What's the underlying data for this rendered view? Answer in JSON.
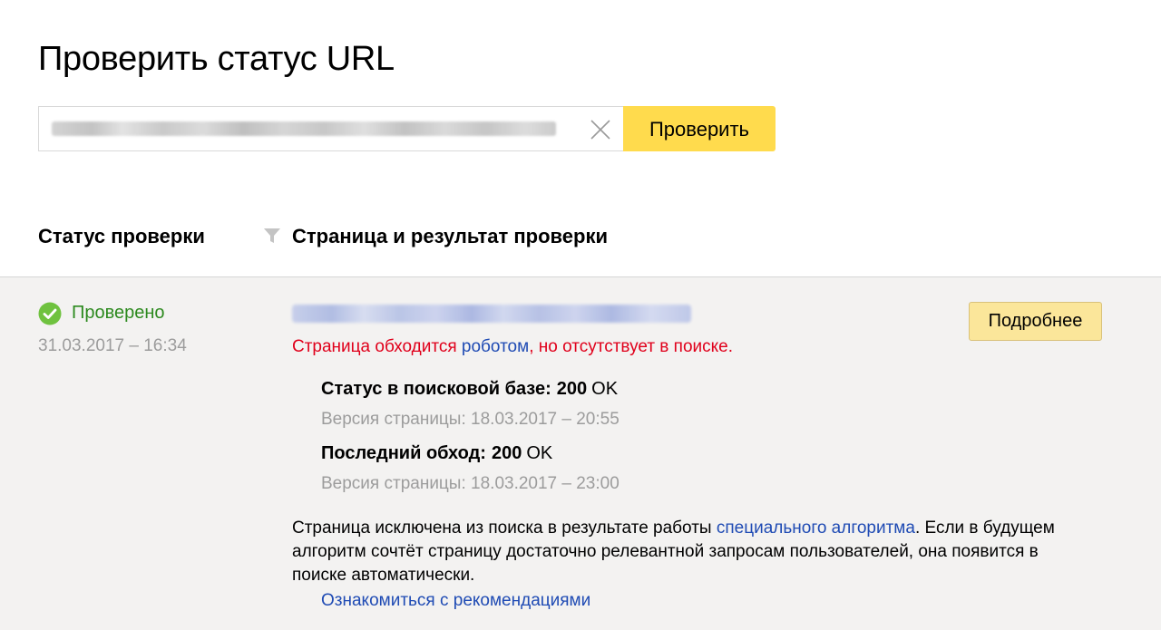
{
  "page": {
    "title": "Проверить статус URL"
  },
  "search": {
    "value": "",
    "clear_icon": "close-icon",
    "button_label": "Проверить",
    "button_color": "#ffdb4d"
  },
  "table": {
    "col_status": "Статус проверки",
    "filter_icon": "filter-icon",
    "col_page": "Страница и результат проверки"
  },
  "result": {
    "status_icon": "check-circle-icon",
    "status_color": "#2d8a1f",
    "status_text": "Проверено",
    "checked_at": "31.03.2017 – 16:34",
    "verdict_pre": "Страница обходится ",
    "verdict_link": "роботом",
    "verdict_post": ", но отсутствует в поиске.",
    "verdict_color": "#e0001b",
    "details_button": "Подробнее",
    "search_base": {
      "label": "Статус в поисковой базе:",
      "code": "200",
      "code_text": "OK",
      "version": "Версия страницы: 18.03.2017 – 20:55"
    },
    "last_crawl": {
      "label": "Последний обход:",
      "code": "200",
      "code_text": "OK",
      "version": "Версия страницы: 18.03.2017 – 23:00"
    },
    "explanation_pre": "Страница исключена из поиска в результате работы ",
    "explanation_link": "специального алгоритма",
    "explanation_post": ". Если в будущем алгоритм сочтёт страницу достаточно релевантной запросам пользователей, она появится в поиске автоматически.",
    "recommendations_link": "Ознакомиться с рекомендациями",
    "link_color": "#1f4bb4"
  }
}
